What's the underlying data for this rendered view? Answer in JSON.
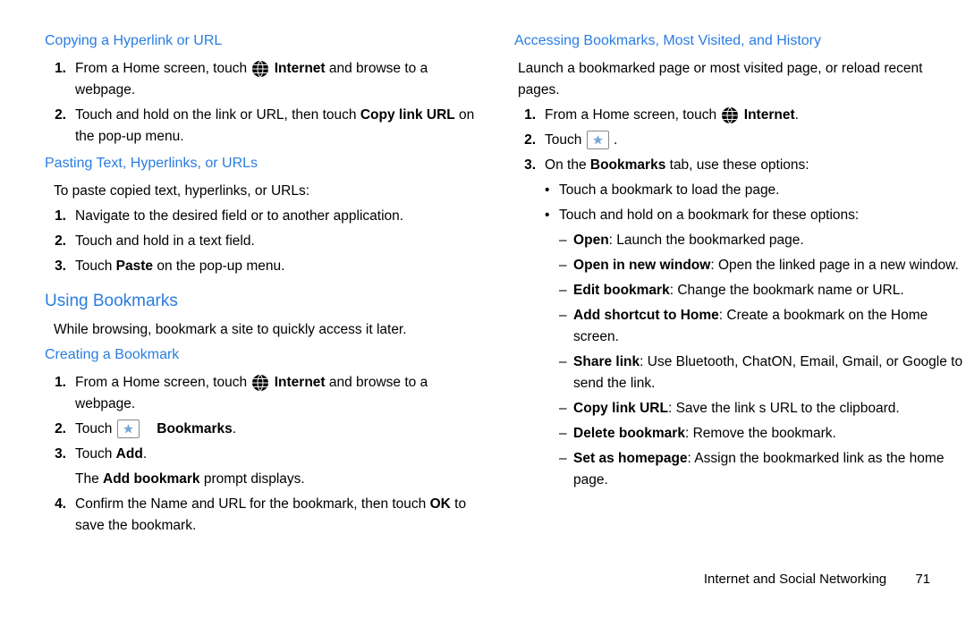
{
  "left": {
    "h1": "Copying a Hyperlink or URL",
    "list1": [
      {
        "pre": "From a Home screen, touch ",
        "bold": "Internet",
        "post": " and browse to a webpage.",
        "globe": true
      },
      {
        "text": "Touch and hold on the link or URL, then touch ",
        "bold": "Copy link URL",
        "post": " on the pop-up menu."
      }
    ],
    "h2": "Pasting Text, Hyperlinks, or URLs",
    "p2": "To paste copied text, hyperlinks, or URLs:",
    "list2": [
      "Navigate to the desired field or to another application.",
      "Touch and hold in a text field."
    ],
    "list2c": {
      "pre": "Touch ",
      "bold": "Paste",
      "post": " on the pop-up menu."
    },
    "h3": "Using Bookmarks",
    "p3": "While browsing, bookmark a site to quickly access it later.",
    "h4": "Creating a Bookmark",
    "list3": {
      "i1": {
        "pre": "From a Home screen, touch ",
        "bold": "Internet",
        "post": " and browse to a webpage."
      },
      "i2_pre": "Touch ",
      "i2_bold": "Bookmarks",
      "i2_post": ".",
      "i3_pre": "Touch ",
      "i3_bold": "Add",
      "i3_post": ".",
      "i3_extra_pre": "The ",
      "i3_extra_bold": "Add bookmark",
      "i3_extra_post": " prompt displays.",
      "i4_pre": "Confirm the Name and URL for the bookmark, then touch ",
      "i4_bold": "OK",
      "i4_post": " to save the bookmark."
    }
  },
  "right": {
    "h1": "Accessing Bookmarks, Most Visited, and History",
    "p1": "Launch a bookmarked page or most visited page, or reload recent pages.",
    "l1_pre": "From a Home screen, touch ",
    "l1_bold": "Internet",
    "l1_post": ".",
    "l2_pre": "Touch ",
    "l2_post": ".",
    "l3_pre": "On the ",
    "l3_bold": "Bookmarks",
    "l3_post": " tab, use these options:",
    "b1": "Touch a bookmark to load the page.",
    "b2": "Touch and hold on a bookmark for these options:",
    "d1_b": "Open",
    "d1": ": Launch the bookmarked page.",
    "d2_b": "Open in new window",
    "d2": ": Open the linked page in a new window.",
    "d3_b": "Edit bookmark",
    "d3": ": Change the bookmark name or URL.",
    "d4_b": "Add shortcut to Home",
    "d4": ": Create a bookmark on the Home screen.",
    "d5_b": "Share link",
    "d5": ": Use Bluetooth, ChatON, Email, Gmail, or Google to send the link.",
    "d6_b": "Copy link URL",
    "d6": ": Save the link s URL to the clipboard.",
    "d7_b": "Delete bookmark",
    "d7": ": Remove the bookmark.",
    "d8_b": "Set as homepage",
    "d8": ": Assign the bookmarked link as the home page."
  },
  "footer": {
    "section": "Internet and Social Networking",
    "page": "71"
  }
}
